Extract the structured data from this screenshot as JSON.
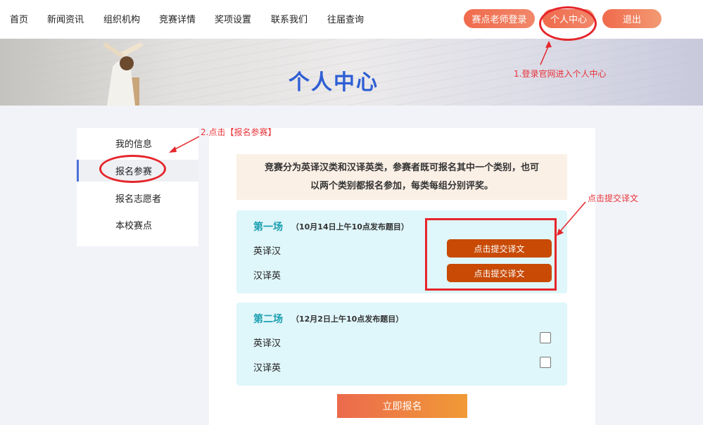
{
  "nav": {
    "items": [
      "首页",
      "新闻资讯",
      "组织机构",
      "竞赛详情",
      "奖项设置",
      "联系我们",
      "往届查询"
    ],
    "teacher_login": "赛点老师登录",
    "personal_center": "个人中心",
    "logout": "退出"
  },
  "banner": {
    "title": "个人中心"
  },
  "sidebar": {
    "items": [
      {
        "label": "我的信息"
      },
      {
        "label": "报名参赛"
      },
      {
        "label": "报名志愿者"
      },
      {
        "label": "本校赛点"
      }
    ]
  },
  "main": {
    "notice_line1": "竞赛分为英译汉类和汉译英类，参赛者既可报名其中一个类别，也可",
    "notice_line2": "以两个类别都报名参加，每类每组分别评奖。",
    "sessions": [
      {
        "title": "第一场",
        "subtitle": "（10月14日上午10点发布题目）",
        "rows": [
          {
            "label": "英译汉",
            "button": "点击提交译文"
          },
          {
            "label": "汉译英",
            "button": "点击提交译文"
          }
        ]
      },
      {
        "title": "第二场",
        "subtitle": "（12月2日上午10点发布题目）",
        "rows": [
          {
            "label": "英译汉"
          },
          {
            "label": "汉译英"
          }
        ]
      }
    ],
    "signup_button": "立即报名"
  },
  "annotations": {
    "step1": "1.登录官网进入个人中心",
    "step2": "2.点击【报名参赛】",
    "step3": "点击提交译文"
  },
  "colors": {
    "accent_orange": "#f06a4c",
    "title_blue": "#2f5fd4",
    "session_bg": "#dff6fa",
    "submit_button": "#c84a05",
    "annotation_red": "#e5262c"
  }
}
